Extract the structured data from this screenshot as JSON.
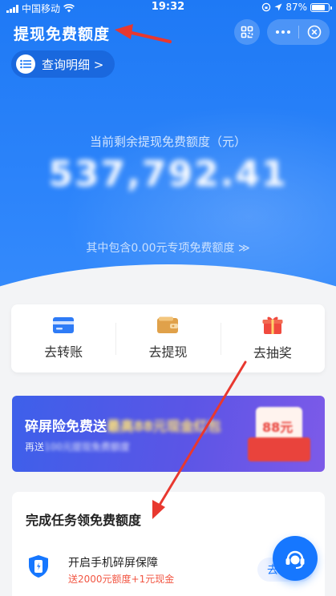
{
  "status_bar": {
    "carrier": "中国移动",
    "time": "19:32",
    "battery": "87%"
  },
  "header": {
    "title": "提现免费额度"
  },
  "query_button": {
    "label": "查询明细 >"
  },
  "quota": {
    "label": "当前剩余提现免费额度（元）",
    "amount": "537,792.41",
    "special_note": "其中包含0.00元专项免费额度 ≫"
  },
  "actions": [
    {
      "label": "去转账",
      "icon": "card-icon"
    },
    {
      "label": "去提现",
      "icon": "wallet-icon"
    },
    {
      "label": "去抽奖",
      "icon": "gift-icon"
    }
  ],
  "banner": {
    "title_prefix": "碎屏险免费送",
    "title_blurred": "最高88元现金红包",
    "subtitle_prefix": "再送",
    "subtitle_blurred": "100元提现免费额度",
    "badge": "88元"
  },
  "tasks": {
    "heading": "完成任务领免费额度",
    "items": [
      {
        "name": "开启手机碎屏保障",
        "reward": "送2000元额度+1元现金",
        "button": "去"
      }
    ]
  },
  "colors": {
    "brand_blue": "#1677ff",
    "reward_red": "#f25643",
    "arrow_red": "#e8382f"
  }
}
